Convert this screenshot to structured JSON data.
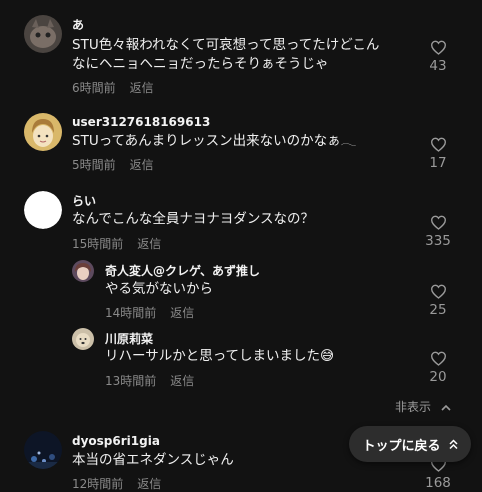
{
  "comments": [
    {
      "username": "あ",
      "text_lines": [
        "STU色々報われなくて可哀想って思ってたけどこん",
        "なにヘニョヘニョだったらそりぁそうじゃ"
      ],
      "time": "6時間前",
      "reply_label": "返信",
      "likes": "43",
      "avatar_icon": "cat-photo-avatar"
    },
    {
      "username": "user3127618169613",
      "text_lines": [
        "STUってあんまりレッスン出来ないのかなぁ𓂃"
      ],
      "time": "5時間前",
      "reply_label": "返信",
      "likes": "17",
      "avatar_icon": "default-face-avatar"
    },
    {
      "username": "らい",
      "text_lines": [
        "なんでこんな全員ナヨナヨダンスなの？"
      ],
      "time": "15時間前",
      "reply_label": "返信",
      "likes": "335",
      "avatar_icon": "white-circle-avatar"
    },
    {
      "username": "奇人変人@クレゲ、あず推し",
      "text_lines": [
        "やる気がないから"
      ],
      "time": "14時間前",
      "reply_label": "返信",
      "likes": "25",
      "avatar_icon": "anime-avatar"
    },
    {
      "username": "川原莉菜",
      "text_lines": [
        "リハーサルかと思ってしまいました😅"
      ],
      "time": "13時間前",
      "reply_label": "返信",
      "likes": "20",
      "avatar_icon": "dog-avatar"
    },
    {
      "username": "dyosp6ri1gia",
      "text_lines": [
        "本当の省エネダンスじゃん"
      ],
      "time": "12時間前",
      "reply_label": "返信",
      "likes": "168",
      "avatar_icon": "night-photo-avatar"
    }
  ],
  "hide_replies_label": "非表示",
  "back_to_top_label": "トップに戻る",
  "colors": {
    "background": "#121212",
    "text": "#efefef",
    "muted": "#8a8a8a",
    "button_bg": "#2d2d2d"
  }
}
